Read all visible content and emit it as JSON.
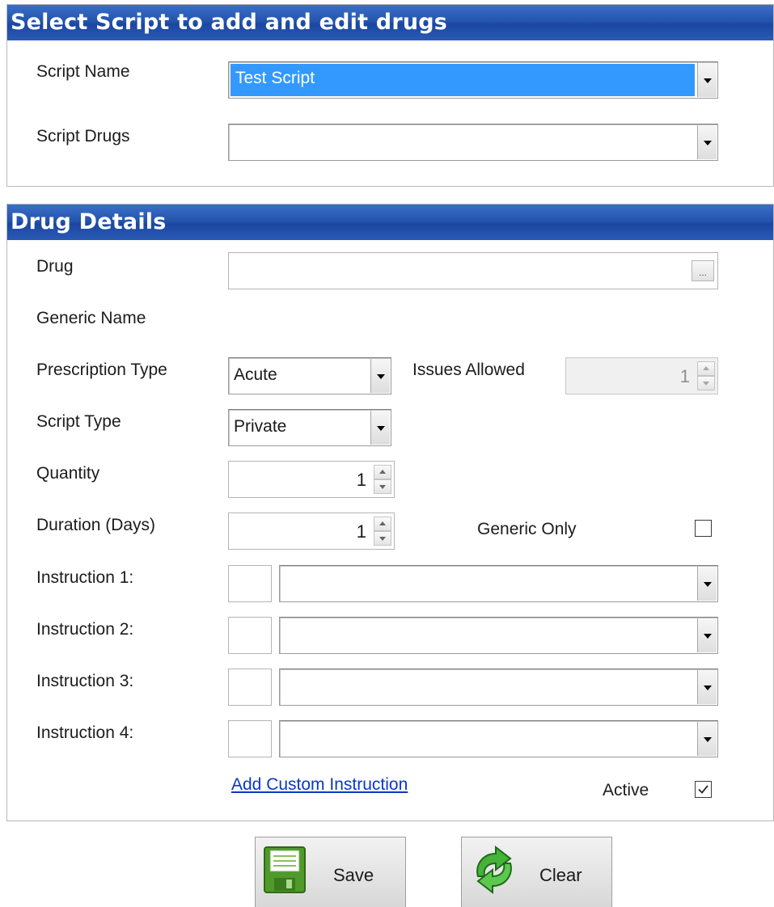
{
  "select_panel": {
    "title": "Select Script to add and edit drugs",
    "script_name_label": "Script Name",
    "script_name_value": "Test Script",
    "script_drugs_label": "Script Drugs",
    "script_drugs_value": ""
  },
  "drug_panel": {
    "title": "Drug Details",
    "drug_label": "Drug",
    "drug_browse_label": "...",
    "generic_name_label": "Generic Name",
    "prescription_type_label": "Prescription Type",
    "prescription_type_value": "Acute",
    "issues_allowed_label": "Issues Allowed",
    "issues_allowed_value": "1",
    "script_type_label": "Script Type",
    "script_type_value": "Private",
    "quantity_label": "Quantity",
    "quantity_value": "1",
    "duration_label": "Duration (Days)",
    "duration_value": "1",
    "generic_only_label": "Generic Only",
    "generic_only_checked": false,
    "instructions": [
      {
        "label": "Instruction 1:",
        "value": ""
      },
      {
        "label": "Instruction 2:",
        "value": ""
      },
      {
        "label": "Instruction 3:",
        "value": ""
      },
      {
        "label": "Instruction 4:",
        "value": ""
      }
    ],
    "add_custom_instruction_link": "Add Custom Instruction",
    "active_label": "Active",
    "active_checked": true
  },
  "buttons": {
    "save_label": "Save",
    "save_icon": "floppy-disk-icon",
    "clear_label": "Clear",
    "clear_icon": "recycle-icon"
  },
  "colors": {
    "header_blue": "#2555ad",
    "selection_blue": "#3399ff",
    "link_blue": "#0b36c9"
  }
}
